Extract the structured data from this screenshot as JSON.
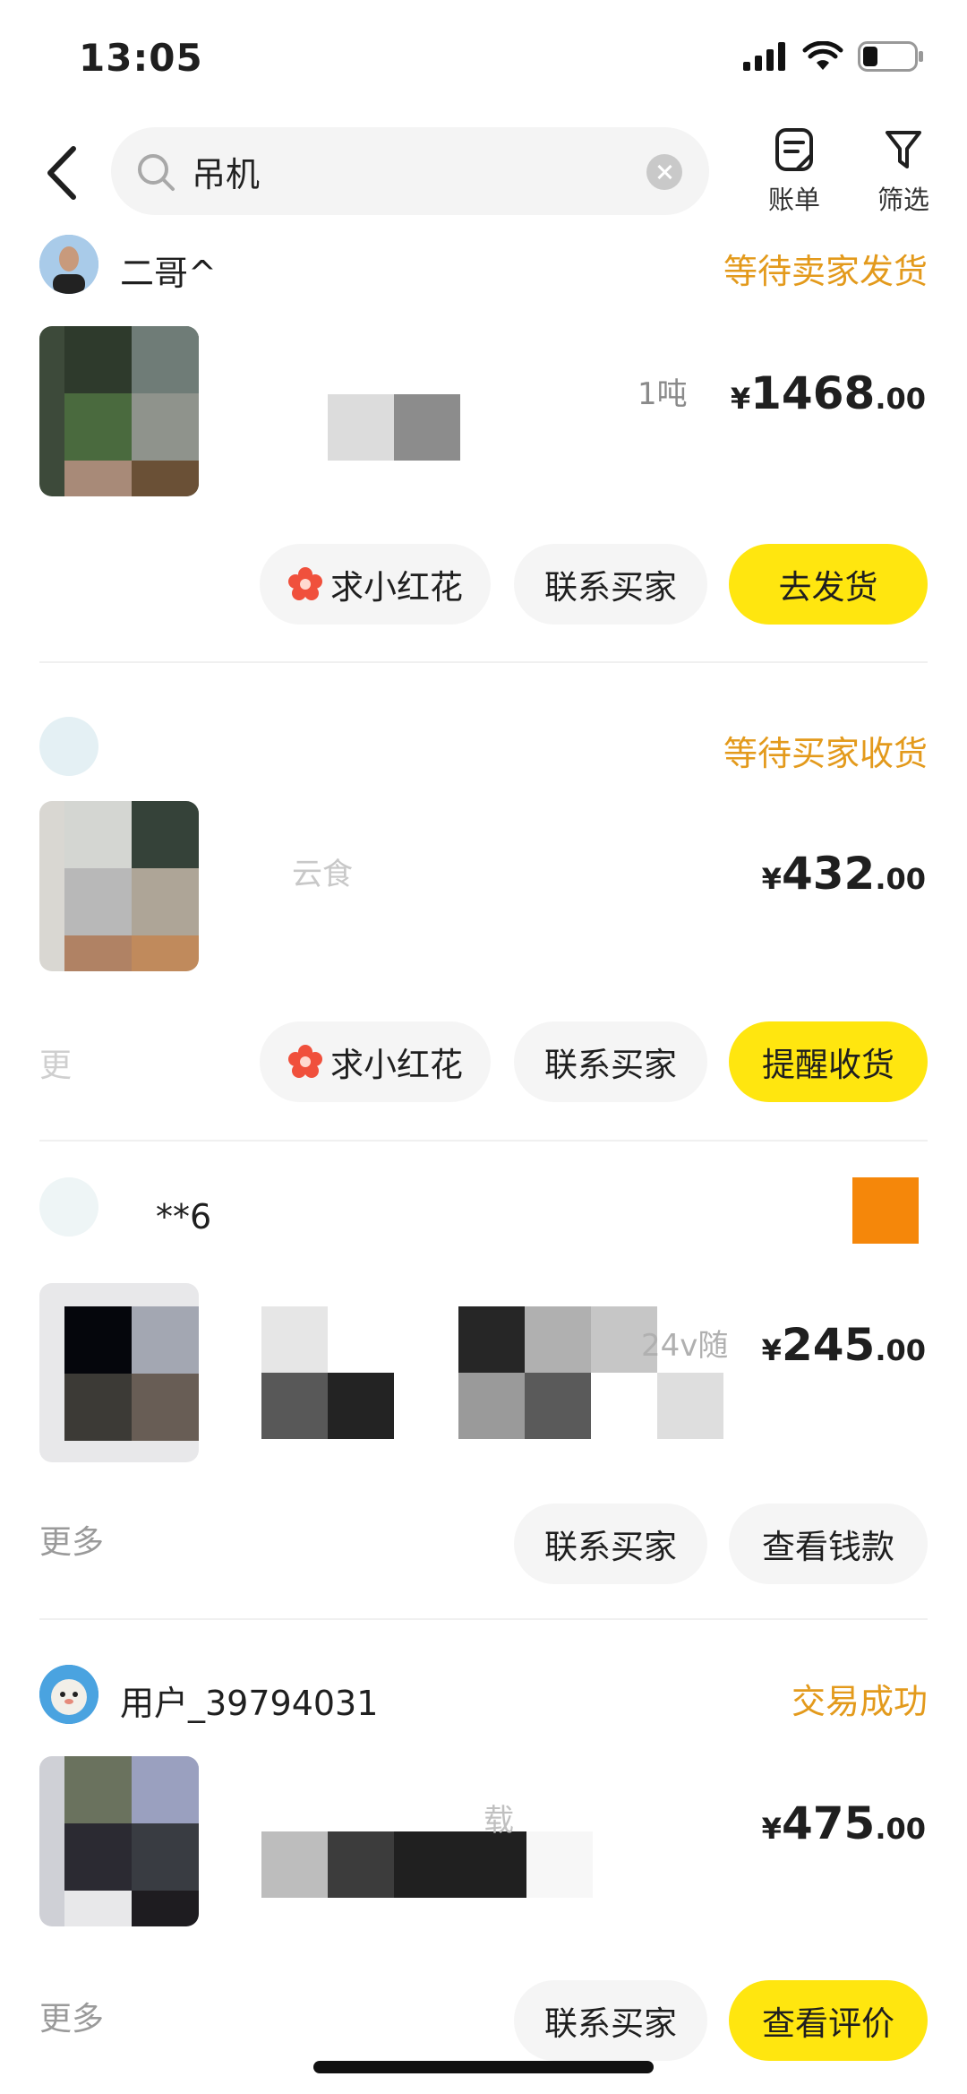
{
  "status_bar": {
    "time": "13:05"
  },
  "header": {
    "search_value": "吊机",
    "bill_label": "账单",
    "filter_label": "筛选"
  },
  "orders": [
    {
      "username": "二哥^",
      "status": "等待卖家发货",
      "title_fragment": "1吨",
      "price_symbol": "¥",
      "price_int": "1468",
      "price_dec": ".00",
      "buttons": [
        "求小红花",
        "联系买家",
        "去发货"
      ]
    },
    {
      "username": "",
      "status": "等待买家收货",
      "title_fragment": "云食",
      "price_symbol": "¥",
      "price_int": "432",
      "price_dec": ".00",
      "more": "更",
      "buttons": [
        "求小红花",
        "联系买家",
        "提醒收货"
      ]
    },
    {
      "username": "**6",
      "status": "",
      "title_fragment": "24v随",
      "price_symbol": "¥",
      "price_int": "245",
      "price_dec": ".00",
      "more": "更多",
      "buttons": [
        "联系买家",
        "查看钱款"
      ]
    },
    {
      "username": "用户_39794031",
      "status": "交易成功",
      "title_fragment": "载",
      "price_symbol": "¥",
      "price_int": "475",
      "price_dec": ".00",
      "more": "更多",
      "buttons": [
        "联系买家",
        "查看评价"
      ]
    }
  ],
  "colors": {
    "accent_yellow": "#ffe60f",
    "status_orange": "#e39a1c",
    "button_grey": "#f5f5f5",
    "flower_red": "#f0503c"
  },
  "icons": {
    "back": "chevron-left-icon",
    "search": "search-icon",
    "clear": "close-circle-icon",
    "bill": "bill-icon",
    "filter": "filter-icon",
    "flower": "flower-icon"
  }
}
